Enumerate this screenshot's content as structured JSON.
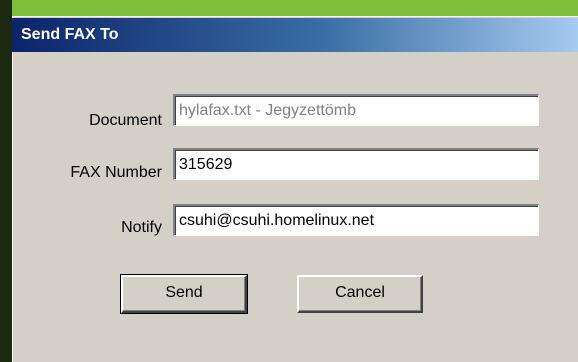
{
  "window": {
    "title": "Send FAX To"
  },
  "form": {
    "document_label": "Document",
    "document_value": "hylafax.txt - Jegyzettömb",
    "fax_label": "FAX Number",
    "fax_value": "315629",
    "notify_label": "Notify",
    "notify_value": "csuhi@csuhi.homelinux.net"
  },
  "buttons": {
    "send_label": "Send",
    "cancel_label": "Cancel"
  },
  "colors": {
    "background": "#7fbf3b",
    "dialog": "#d4d0c8",
    "titlebar_start": "#0b246a",
    "titlebar_end": "#a6caf0"
  }
}
